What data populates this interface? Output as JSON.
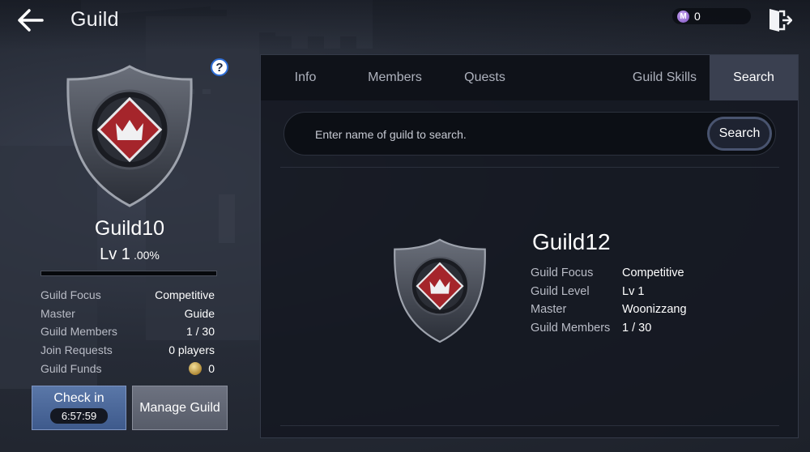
{
  "header": {
    "title": "Guild",
    "currency_value": "0",
    "currency_icon": "m-coin-icon"
  },
  "my_guild": {
    "name": "Guild10",
    "level": "Lv 1",
    "level_percent": ".00%",
    "xp_fraction": 0,
    "stats": [
      {
        "label": "Guild Focus",
        "value": "Competitive"
      },
      {
        "label": "Master",
        "value": "Guide"
      },
      {
        "label": "Guild Members",
        "value": "1 / 30"
      },
      {
        "label": "Join Requests",
        "value": "0 players"
      },
      {
        "label": "Guild Funds",
        "value": "0"
      }
    ],
    "checkin_label": "Check in",
    "checkin_timer": "6:57:59",
    "manage_label": "Manage Guild"
  },
  "tabs": [
    {
      "label": "Info",
      "active": false
    },
    {
      "label": "Members",
      "active": false
    },
    {
      "label": "Quests",
      "active": false
    },
    {
      "label": "Guild Skills",
      "active": false
    },
    {
      "label": "Search",
      "active": true
    }
  ],
  "search": {
    "placeholder": "Enter name of guild to search.",
    "value": "",
    "button_label": "Search"
  },
  "result": {
    "name": "Guild12",
    "info": [
      {
        "label": "Guild Focus",
        "value": "Competitive"
      },
      {
        "label": "Guild Level",
        "value": "Lv 1"
      },
      {
        "label": "Master",
        "value": "Woonizzang"
      },
      {
        "label": "Guild Members",
        "value": "1 / 30"
      }
    ]
  },
  "colors": {
    "accent_blue": "#3e5a8c",
    "tab_active": "#3a4050",
    "emblem_red": "#a5252b"
  }
}
